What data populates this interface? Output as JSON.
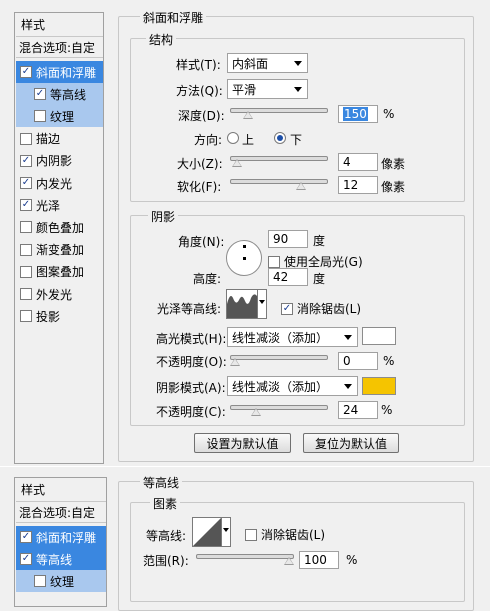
{
  "styles_panel": {
    "title": "样式",
    "blend_options": "混合选项:自定",
    "items": [
      {
        "label": "斜面和浮雕",
        "checked": true,
        "state": "selected"
      },
      {
        "label": "等高线",
        "checked": true,
        "state": "sub"
      },
      {
        "label": "纹理",
        "checked": false,
        "state": "sub"
      },
      {
        "label": "描边",
        "checked": false
      },
      {
        "label": "内阴影",
        "checked": true
      },
      {
        "label": "内发光",
        "checked": true
      },
      {
        "label": "光泽",
        "checked": true
      },
      {
        "label": "颜色叠加",
        "checked": false
      },
      {
        "label": "渐变叠加",
        "checked": false
      },
      {
        "label": "图案叠加",
        "checked": false
      },
      {
        "label": "外发光",
        "checked": false
      },
      {
        "label": "投影",
        "checked": false
      }
    ]
  },
  "bevel": {
    "title": "斜面和浮雕",
    "structure": {
      "title": "结构",
      "style_label": "样式(T):",
      "style_value": "内斜面",
      "technique_label": "方法(Q):",
      "technique_value": "平滑",
      "depth_label": "深度(D):",
      "depth_value": "150",
      "depth_unit": "%",
      "depth_level": 0.15,
      "direction_label": "方向:",
      "direction_up": "上",
      "direction_down": "下",
      "direction_selected": "down",
      "size_label": "大小(Z):",
      "size_value": "4",
      "size_unit": "像素",
      "size_level": 0.02,
      "soften_label": "软化(F):",
      "soften_value": "12",
      "soften_unit": "像素",
      "soften_level": 0.75
    },
    "shading": {
      "title": "阴影",
      "angle_label": "角度(N):",
      "angle_value": "90",
      "angle_unit": "度",
      "global_light_label": "使用全局光(G)",
      "global_light_checked": false,
      "altitude_label": "高度:",
      "altitude_value": "42",
      "altitude_unit": "度",
      "gloss_contour_label": "光泽等高线:",
      "antialias_label": "消除锯齿(L)",
      "antialias_checked": true,
      "highlight_mode_label": "高光模式(H):",
      "highlight_mode_value": "线性减淡（添加）",
      "highlight_color": "#ffffff",
      "highlight_opacity_label": "不透明度(O):",
      "highlight_opacity_value": "0",
      "highlight_opacity_unit": "%",
      "highlight_opacity_level": 0.0,
      "shadow_mode_label": "阴影模式(A):",
      "shadow_mode_value": "线性减淡（添加）",
      "shadow_color": "#f5c400",
      "shadow_opacity_label": "不透明度(C):",
      "shadow_opacity_value": "24",
      "shadow_opacity_unit": "%",
      "shadow_opacity_level": 0.24
    },
    "make_default": "设置为默认值",
    "reset_default": "复位为默认值"
  },
  "styles_panel_2": {
    "title": "样式",
    "blend_options": "混合选项:自定",
    "items": [
      {
        "label": "斜面和浮雕",
        "checked": true,
        "state": "selected"
      },
      {
        "label": "等高线",
        "checked": true,
        "state": "selected"
      },
      {
        "label": "纹理",
        "checked": false,
        "state": "sub"
      }
    ]
  },
  "contour_section": {
    "title": "等高线",
    "elements_title": "图素",
    "contour_label": "等高线:",
    "antialias_label": "消除锯齿(L)",
    "antialias_checked": false,
    "range_label": "范围(R):",
    "range_value": "100",
    "range_unit": "%",
    "range_level": 1.0
  },
  "colors": {
    "selection_blue": "#3a87e0",
    "sub_item_blue": "#a9c8ee",
    "dialog_bg": "#f0f0f0"
  }
}
